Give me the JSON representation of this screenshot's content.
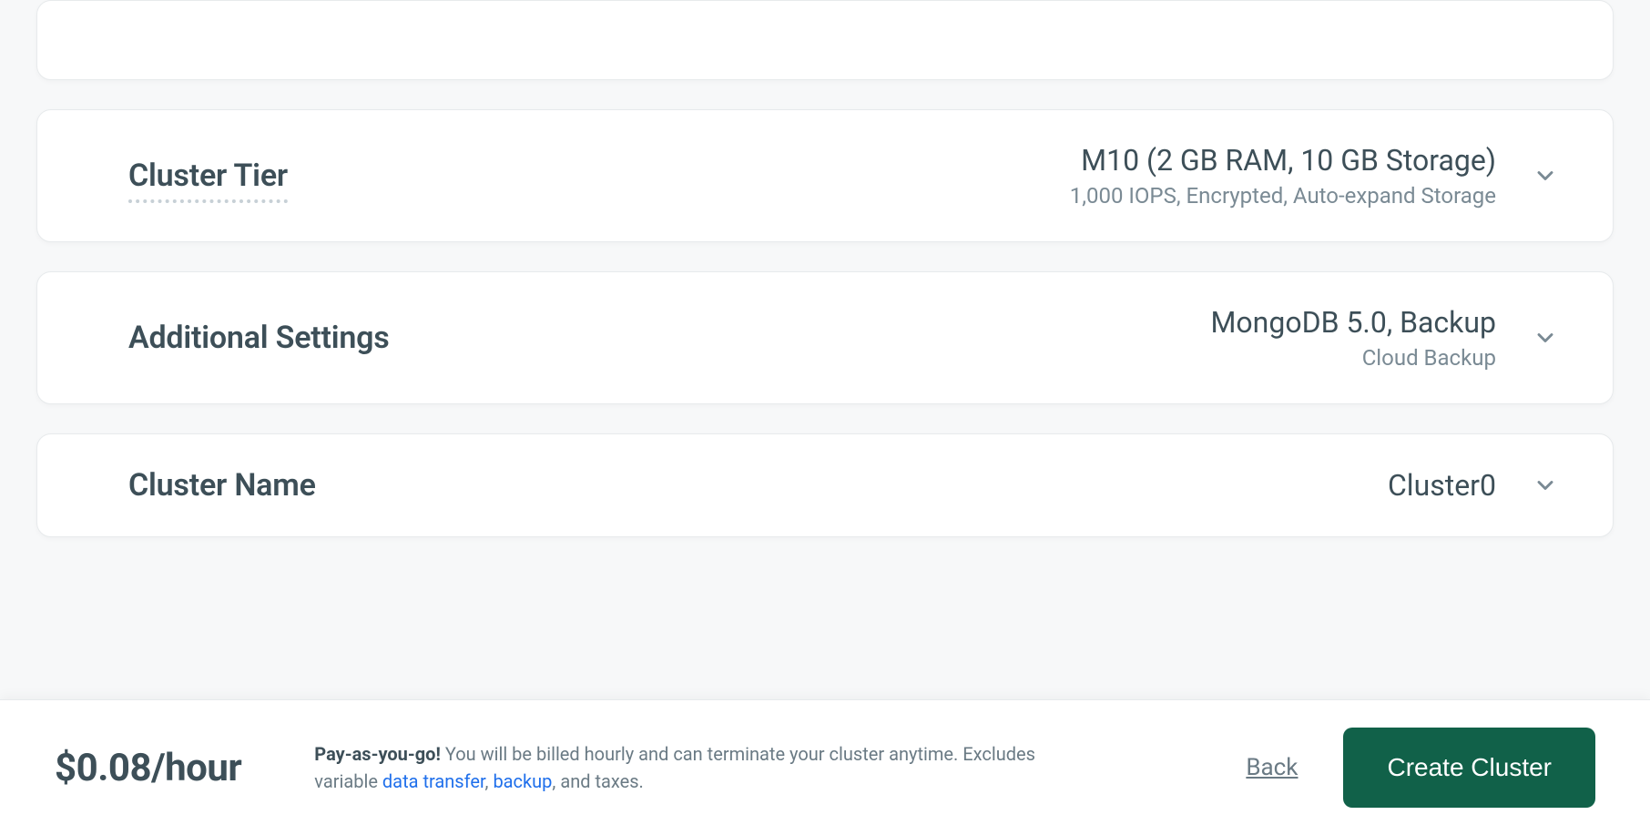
{
  "tier": {
    "title": "Cluster Tier",
    "main": "M10 (2 GB RAM, 10 GB Storage)",
    "sub": "1,000 IOPS, Encrypted, Auto-expand Storage"
  },
  "settings": {
    "title": "Additional Settings",
    "main": "MongoDB 5.0, Backup",
    "sub": "Cloud Backup"
  },
  "name": {
    "title": "Cluster Name",
    "main": "Cluster0"
  },
  "footer": {
    "price": "$0.08/hour",
    "payg_bold": "Pay-as-you-go!",
    "payg_part1": " You will be billed hourly and can terminate your cluster anytime. Excludes variable ",
    "link_transfer": "data transfer",
    "comma": ", ",
    "link_backup": "backup",
    "payg_part2": ", and taxes.",
    "back": "Back",
    "create": "Create Cluster"
  }
}
